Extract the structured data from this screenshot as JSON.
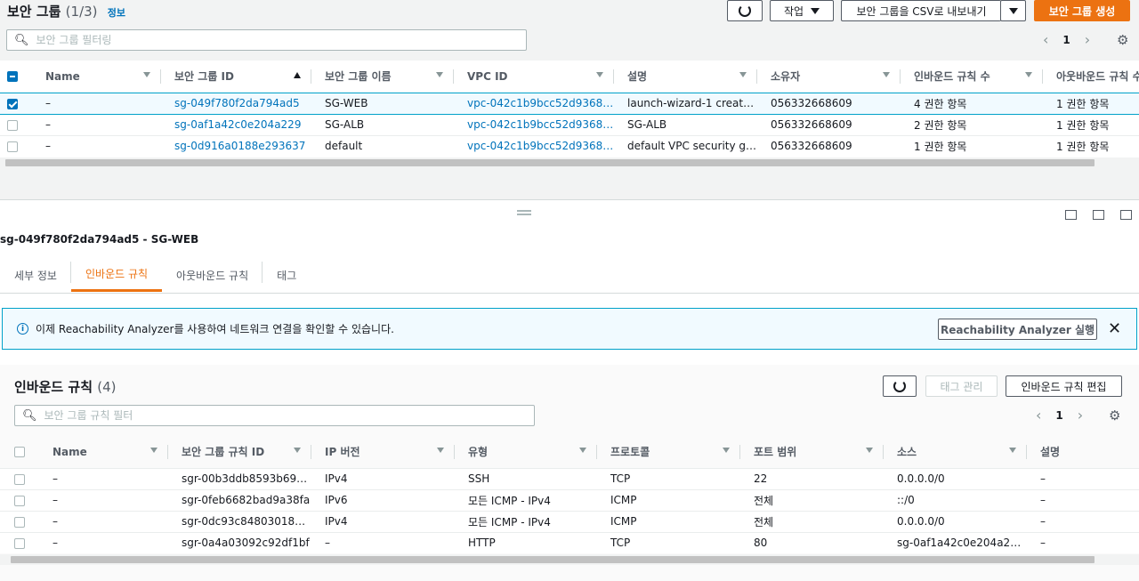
{
  "header": {
    "title": "보안 그룹",
    "count": "(1/3)",
    "info": "정보",
    "actions_label": "작업",
    "export_label": "보안 그룹을 CSV로 내보내기",
    "create_label": "보안 그룹 생성",
    "search_placeholder": "보안 그룹 필터링",
    "page": "1"
  },
  "sg_table": {
    "columns": [
      "Name",
      "보안 그룹 ID",
      "보안 그룹 이름",
      "VPC ID",
      "설명",
      "소유자",
      "인바운드 규칙 수",
      "아웃바운드 규칙 수"
    ],
    "rows": [
      {
        "name": "–",
        "id": "sg-049f780f2da794ad5",
        "gname": "SG-WEB",
        "vpc": "vpc-042c1b9bcc52d9368",
        "desc": "launch-wizard-1 create…",
        "owner": "056332668609",
        "inbound": "4 권한 항목",
        "outbound": "1 권한 항목"
      },
      {
        "name": "–",
        "id": "sg-0af1a42c0e204a229",
        "gname": "SG-ALB",
        "vpc": "vpc-042c1b9bcc52d9368",
        "desc": "SG-ALB",
        "owner": "056332668609",
        "inbound": "2 권한 항목",
        "outbound": "1 권한 항목"
      },
      {
        "name": "–",
        "id": "sg-0d916a0188e293637",
        "gname": "default",
        "vpc": "vpc-042c1b9bcc52d9368",
        "desc": "default VPC security gr…",
        "owner": "056332668609",
        "inbound": "1 권한 항목",
        "outbound": "1 권한 항목"
      }
    ]
  },
  "detail": {
    "title": "sg-049f780f2da794ad5 - SG-WEB",
    "tabs": [
      "세부 정보",
      "인바운드 규칙",
      "아웃바운드 규칙",
      "태그"
    ]
  },
  "alert": {
    "text": "이제 Reachability Analyzer를 사용하여 네트워크 연결을 확인할 수 있습니다.",
    "button": "Reachability Analyzer 실행"
  },
  "rules": {
    "title": "인바운드 규칙",
    "count": "(4)",
    "manage_tags": "태그 관리",
    "edit": "인바운드 규칙 편집",
    "search_placeholder": "보안 그룹 규칙 필터",
    "page": "1",
    "columns": [
      "Name",
      "보안 그룹 규칙 ID",
      "IP 버전",
      "유형",
      "프로토콜",
      "포트 범위",
      "소스",
      "설명"
    ],
    "rows": [
      {
        "name": "–",
        "id": "sgr-00b3ddb8593b69…",
        "ip": "IPv4",
        "type": "SSH",
        "proto": "TCP",
        "port": "22",
        "src": "0.0.0.0/0",
        "desc": "–"
      },
      {
        "name": "–",
        "id": "sgr-0feb6682bad9a38fa",
        "ip": "IPv6",
        "type": "모든 ICMP - IPv4",
        "proto": "ICMP",
        "port": "전체",
        "src": "::/0",
        "desc": "–"
      },
      {
        "name": "–",
        "id": "sgr-0dc93c848030183…",
        "ip": "IPv4",
        "type": "모든 ICMP - IPv4",
        "proto": "ICMP",
        "port": "전체",
        "src": "0.0.0.0/0",
        "desc": "–"
      },
      {
        "name": "–",
        "id": "sgr-0a4a03092c92df1bf",
        "ip": "–",
        "type": "HTTP",
        "proto": "TCP",
        "port": "80",
        "src": "sg-0af1a42c0e204a22…",
        "desc": "–"
      }
    ]
  }
}
